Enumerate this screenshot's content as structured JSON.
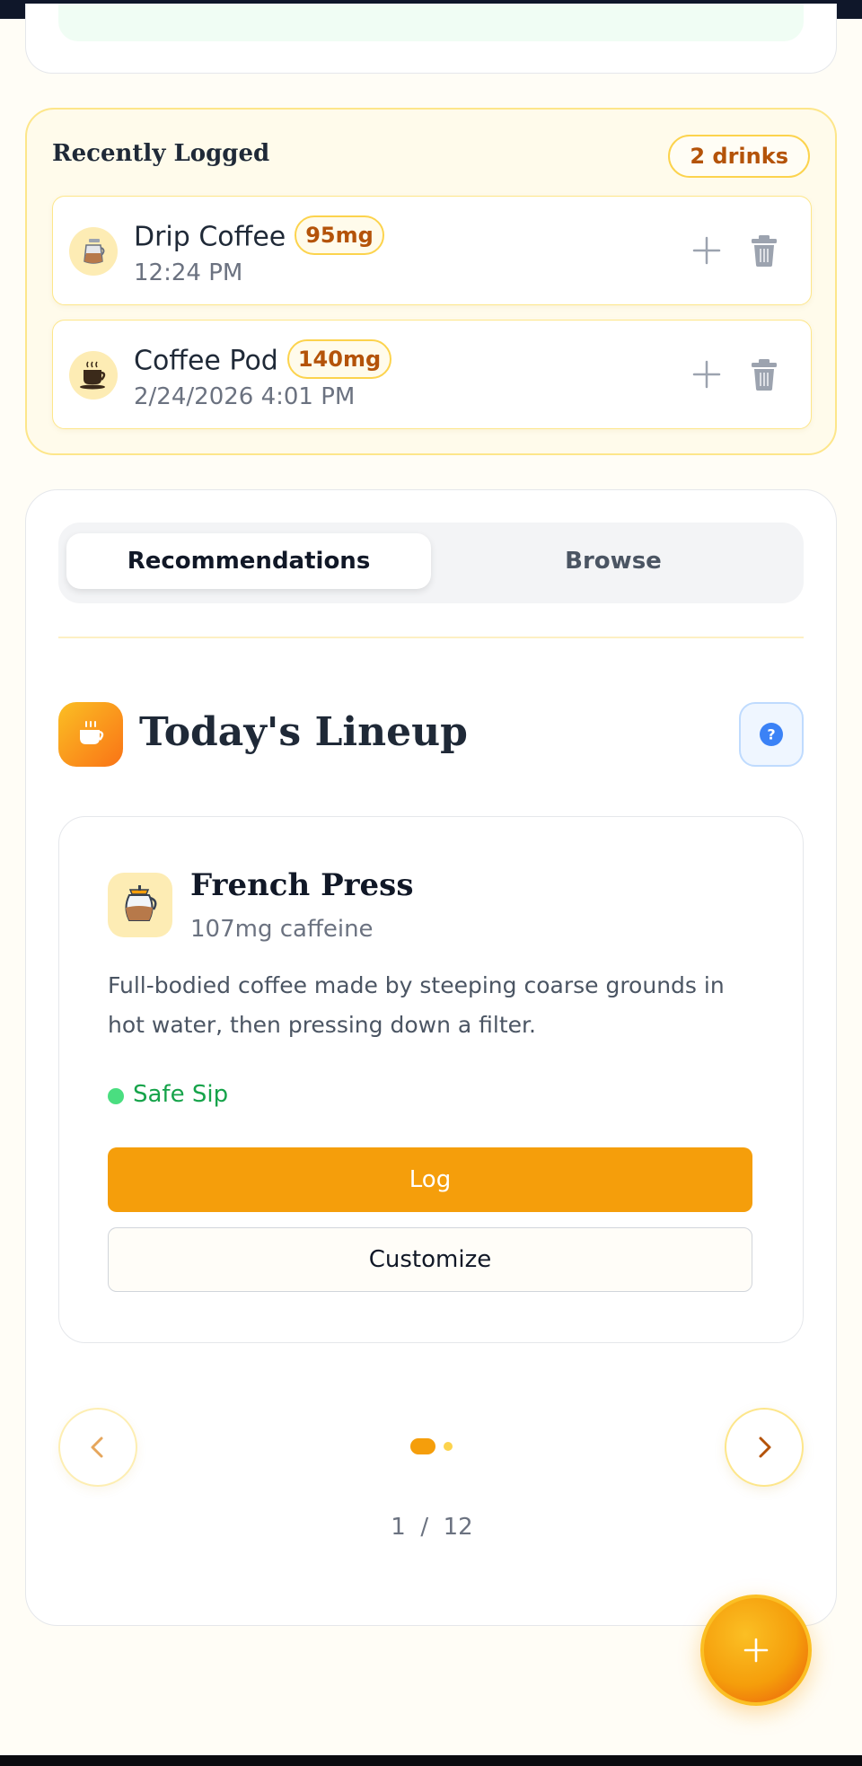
{
  "recent": {
    "title": "Recently Logged",
    "count": "2 drinks",
    "items": [
      {
        "name": "Drip Coffee",
        "caffeine": "95mg",
        "time": "12:24 PM",
        "icon": "drip-coffee-icon"
      },
      {
        "name": "Coffee Pod",
        "caffeine": "140mg",
        "time": "2/24/2026 4:01 PM",
        "icon": "coffee-cup-icon"
      }
    ]
  },
  "tabs": {
    "recommendations": "Recommendations",
    "browse": "Browse",
    "active": "Recommendations"
  },
  "lineup": {
    "title": "Today's Lineup",
    "icon": "coffee-cup-icon",
    "help_icon": "question-icon"
  },
  "drink": {
    "name": "French Press",
    "caffeine": "107mg caffeine",
    "description": "Full-bodied coffee made by steeping coarse grounds in hot water, then pressing down a filter.",
    "safety": "Safe Sip",
    "log_label": "Log",
    "customize_label": "Customize",
    "icon": "french-press-icon"
  },
  "pager": {
    "current": "1",
    "separator": "/",
    "total": "12"
  },
  "colors": {
    "accent": "#f59e0b",
    "safe": "#16a34a",
    "badge_text": "#b45309"
  }
}
